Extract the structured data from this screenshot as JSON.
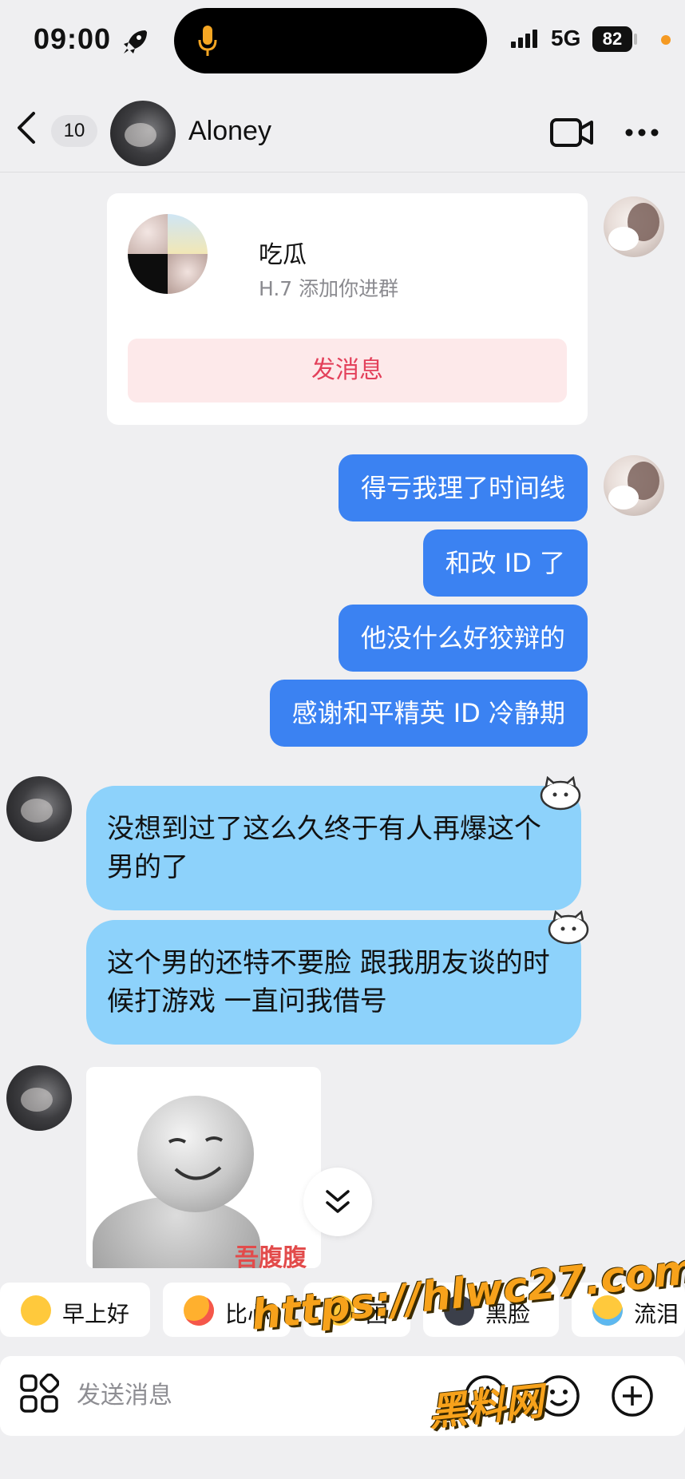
{
  "status_bar": {
    "time": "09:00",
    "network": "5G",
    "battery": "82"
  },
  "header": {
    "unread_count": "10",
    "contact_name": "Aloney"
  },
  "group_invite": {
    "group_name": "吃瓜",
    "subtitle": "H.7 添加你进群",
    "action_label": "发消息"
  },
  "outgoing_messages": [
    "得亏我理了时间线",
    "和改 ID 了",
    "他没什么好狡辩的",
    "感谢和平精英 ID 冷静期"
  ],
  "incoming_messages": [
    "没想到过了这么久终于有人再爆这个男的了",
    "这个男的还特不要脸 跟我朋友谈的时候打游戏 一直问我借号"
  ],
  "sticker_caption": "吾腹腹",
  "quick_replies": [
    {
      "label": "早上好",
      "icon": "sun-emoji-icon"
    },
    {
      "label": "比心",
      "icon": "heart-hands-emoji-icon"
    },
    {
      "label": "困",
      "icon": "sleepy-emoji-icon"
    },
    {
      "label": "黑脸",
      "icon": "dark-face-emoji-icon"
    },
    {
      "label": "流泪",
      "icon": "crying-emoji-icon"
    }
  ],
  "input": {
    "placeholder": "发送消息"
  },
  "watermark": {
    "url": "https://hlwc27.com",
    "name": "黑料网"
  },
  "colors": {
    "outgoing_bubble": "#3b82f2",
    "incoming_bubble": "#8dd2fb",
    "action_text": "#e3405a",
    "action_bg": "#fde9ea",
    "watermark": "#f7a21b"
  }
}
